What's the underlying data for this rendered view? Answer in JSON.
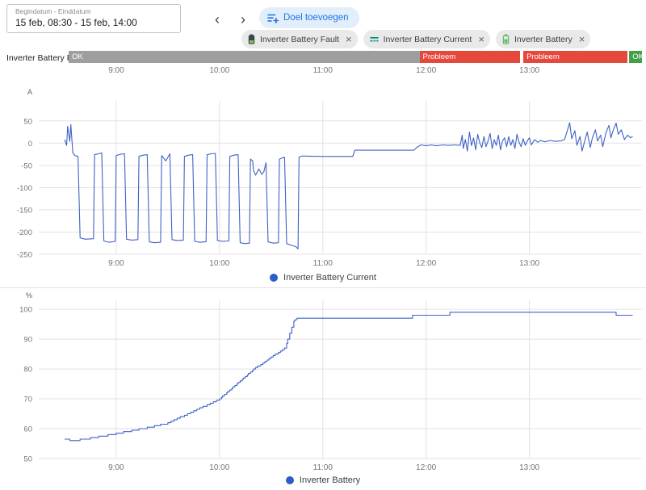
{
  "header": {
    "date_range": {
      "label": "Begindatum - Einddatum",
      "value": "15 feb, 08:30 - 15 feb, 14:00"
    },
    "goal_button_label": "Doel toevoegen",
    "prev_glyph": "‹",
    "next_glyph": "›",
    "close_glyph": "×",
    "chips": [
      {
        "label": "Inverter Battery Fault",
        "icon": "battery-fault-icon"
      },
      {
        "label": "Inverter Battery Current",
        "icon": "battery-current-icon"
      },
      {
        "label": "Inverter Battery",
        "icon": "battery-icon"
      }
    ]
  },
  "status_row": {
    "label": "Inverter Battery Fault",
    "axis_min": 8.5,
    "axis_max": 14.0,
    "segments": [
      {
        "label": "OK",
        "start": 8.5,
        "end": 11.866,
        "color": "#9e9e9e"
      },
      {
        "label": "Probleem",
        "start": 11.866,
        "end": 12.829,
        "color": "#e5483c"
      },
      {
        "label": "Probleem",
        "start": 12.862,
        "end": 13.858,
        "color": "#e5483c"
      },
      {
        "label": "OK",
        "start": 13.878,
        "end": 14.0,
        "color": "#43a047"
      }
    ]
  },
  "time_axis": {
    "xmin": 8.25,
    "xmax": 14.09,
    "ticks": [
      9,
      10,
      11,
      12,
      13
    ],
    "labels": [
      "9:00",
      "10:00",
      "11:00",
      "12:00",
      "13:00"
    ]
  },
  "colors": {
    "line": "#3f62c6",
    "legend_dot": "#2d5bc9",
    "grid": "#e2e2e2",
    "tick_text": "#757575",
    "unit_text": "#616161"
  },
  "chart_data": [
    {
      "type": "line",
      "name": "inverter-battery-current",
      "legend": "Inverter Battery Current",
      "unit": "A",
      "ylim": [
        -250,
        95
      ],
      "yticks": [
        50,
        0,
        -50,
        -100,
        -150,
        -200,
        -250
      ],
      "interpolation": "linear",
      "x_unit": "hour_of_day",
      "points": [
        [
          8.5,
          8
        ],
        [
          8.52,
          -5
        ],
        [
          8.53,
          38
        ],
        [
          8.55,
          4
        ],
        [
          8.56,
          42
        ],
        [
          8.58,
          -22
        ],
        [
          8.6,
          -28
        ],
        [
          8.63,
          -30
        ],
        [
          8.65,
          -213
        ],
        [
          8.7,
          -216
        ],
        [
          8.78,
          -215
        ],
        [
          8.79,
          -26
        ],
        [
          8.83,
          -24
        ],
        [
          8.86,
          -22
        ],
        [
          8.88,
          -220
        ],
        [
          8.93,
          -223
        ],
        [
          8.99,
          -221
        ],
        [
          9.0,
          -28
        ],
        [
          9.04,
          -25
        ],
        [
          9.08,
          -24
        ],
        [
          9.1,
          -216
        ],
        [
          9.15,
          -218
        ],
        [
          9.21,
          -217
        ],
        [
          9.22,
          -30
        ],
        [
          9.26,
          -27
        ],
        [
          9.3,
          -26
        ],
        [
          9.32,
          -222
        ],
        [
          9.37,
          -224
        ],
        [
          9.43,
          -223
        ],
        [
          9.44,
          -28
        ],
        [
          9.48,
          -40
        ],
        [
          9.52,
          -24
        ],
        [
          9.54,
          -217
        ],
        [
          9.59,
          -219
        ],
        [
          9.65,
          -218
        ],
        [
          9.66,
          -30
        ],
        [
          9.7,
          -27
        ],
        [
          9.74,
          -26
        ],
        [
          9.76,
          -221
        ],
        [
          9.81,
          -223
        ],
        [
          9.87,
          -222
        ],
        [
          9.88,
          -26
        ],
        [
          9.92,
          -24
        ],
        [
          9.96,
          -23
        ],
        [
          9.98,
          -219
        ],
        [
          10.03,
          -221
        ],
        [
          10.09,
          -220
        ],
        [
          10.1,
          -30
        ],
        [
          10.14,
          -27
        ],
        [
          10.18,
          -26
        ],
        [
          10.2,
          -224
        ],
        [
          10.25,
          -226
        ],
        [
          10.29,
          -225
        ],
        [
          10.3,
          -36
        ],
        [
          10.32,
          -40
        ],
        [
          10.33,
          -62
        ],
        [
          10.35,
          -72
        ],
        [
          10.38,
          -58
        ],
        [
          10.41,
          -70
        ],
        [
          10.43,
          -64
        ],
        [
          10.45,
          -44
        ],
        [
          10.47,
          -222
        ],
        [
          10.52,
          -225
        ],
        [
          10.57,
          -224
        ],
        [
          10.58,
          -36
        ],
        [
          10.61,
          -33
        ],
        [
          10.63,
          -32
        ],
        [
          10.65,
          -226
        ],
        [
          10.7,
          -230
        ],
        [
          10.74,
          -233
        ],
        [
          10.76,
          -238
        ],
        [
          10.77,
          -32
        ],
        [
          10.8,
          -29
        ],
        [
          11.0,
          -30
        ],
        [
          11.29,
          -30
        ],
        [
          11.31,
          -16
        ],
        [
          11.6,
          -16
        ],
        [
          11.88,
          -16
        ],
        [
          11.92,
          -8
        ],
        [
          11.95,
          -4
        ],
        [
          12.0,
          -6
        ],
        [
          12.05,
          -4
        ],
        [
          12.1,
          -6
        ],
        [
          12.16,
          -4
        ],
        [
          12.22,
          -5
        ],
        [
          12.28,
          -4
        ],
        [
          12.33,
          -5
        ],
        [
          12.35,
          18
        ],
        [
          12.36,
          -12
        ],
        [
          12.38,
          8
        ],
        [
          12.4,
          -18
        ],
        [
          12.42,
          25
        ],
        [
          12.44,
          -6
        ],
        [
          12.46,
          12
        ],
        [
          12.48,
          -15
        ],
        [
          12.5,
          20
        ],
        [
          12.52,
          0
        ],
        [
          12.54,
          -10
        ],
        [
          12.56,
          15
        ],
        [
          12.58,
          -8
        ],
        [
          12.6,
          5
        ],
        [
          12.62,
          22
        ],
        [
          12.64,
          -12
        ],
        [
          12.66,
          8
        ],
        [
          12.68,
          -5
        ],
        [
          12.7,
          18
        ],
        [
          12.72,
          -15
        ],
        [
          12.74,
          5
        ],
        [
          12.76,
          12
        ],
        [
          12.78,
          -8
        ],
        [
          12.8,
          15
        ],
        [
          12.82,
          -5
        ],
        [
          12.84,
          8
        ],
        [
          12.86,
          -12
        ],
        [
          12.88,
          20
        ],
        [
          12.9,
          2
        ],
        [
          12.92,
          -8
        ],
        [
          12.94,
          10
        ],
        [
          12.96,
          -5
        ],
        [
          12.98,
          5
        ],
        [
          13.0,
          12
        ],
        [
          13.02,
          -4
        ],
        [
          13.05,
          8
        ],
        [
          13.08,
          2
        ],
        [
          13.11,
          6
        ],
        [
          13.15,
          3
        ],
        [
          13.2,
          6
        ],
        [
          13.25,
          4
        ],
        [
          13.3,
          5
        ],
        [
          13.34,
          8
        ],
        [
          13.37,
          30
        ],
        [
          13.39,
          46
        ],
        [
          13.41,
          10
        ],
        [
          13.44,
          28
        ],
        [
          13.46,
          -5
        ],
        [
          13.49,
          15
        ],
        [
          13.51,
          -18
        ],
        [
          13.54,
          8
        ],
        [
          13.56,
          25
        ],
        [
          13.59,
          -10
        ],
        [
          13.61,
          12
        ],
        [
          13.64,
          30
        ],
        [
          13.66,
          5
        ],
        [
          13.69,
          18
        ],
        [
          13.71,
          -8
        ],
        [
          13.74,
          22
        ],
        [
          13.77,
          40
        ],
        [
          13.79,
          12
        ],
        [
          13.81,
          28
        ],
        [
          13.84,
          45
        ],
        [
          13.86,
          20
        ],
        [
          13.89,
          30
        ],
        [
          13.92,
          8
        ],
        [
          13.95,
          18
        ],
        [
          13.98,
          12
        ],
        [
          14.0,
          15
        ]
      ]
    },
    {
      "type": "line",
      "name": "inverter-battery",
      "legend": "Inverter Battery",
      "unit": "%",
      "ylim": [
        50,
        103
      ],
      "yticks": [
        100,
        90,
        80,
        70,
        60,
        50
      ],
      "interpolation": "step-after",
      "x_unit": "hour_of_day",
      "points": [
        [
          8.5,
          56.5
        ],
        [
          8.55,
          56
        ],
        [
          8.65,
          56.5
        ],
        [
          8.75,
          57
        ],
        [
          8.83,
          57.5
        ],
        [
          8.92,
          58
        ],
        [
          9.0,
          58.5
        ],
        [
          9.07,
          59
        ],
        [
          9.15,
          59.5
        ],
        [
          9.22,
          60
        ],
        [
          9.3,
          60.5
        ],
        [
          9.37,
          61
        ],
        [
          9.43,
          61.5
        ],
        [
          9.5,
          62
        ],
        [
          9.53,
          62.5
        ],
        [
          9.56,
          63
        ],
        [
          9.59,
          63.5
        ],
        [
          9.62,
          64
        ],
        [
          9.66,
          64.5
        ],
        [
          9.69,
          65
        ],
        [
          9.72,
          65.5
        ],
        [
          9.75,
          66
        ],
        [
          9.78,
          66.5
        ],
        [
          9.81,
          67
        ],
        [
          9.84,
          67.5
        ],
        [
          9.88,
          68
        ],
        [
          9.91,
          68.5
        ],
        [
          9.94,
          69
        ],
        [
          9.97,
          69.5
        ],
        [
          10.0,
          70
        ],
        [
          10.02,
          70.5
        ],
        [
          10.03,
          71
        ],
        [
          10.05,
          71.5
        ],
        [
          10.07,
          72
        ],
        [
          10.08,
          72.5
        ],
        [
          10.1,
          73
        ],
        [
          10.12,
          73.5
        ],
        [
          10.13,
          74
        ],
        [
          10.15,
          74.5
        ],
        [
          10.17,
          75
        ],
        [
          10.18,
          75.5
        ],
        [
          10.2,
          76
        ],
        [
          10.22,
          76.5
        ],
        [
          10.23,
          77
        ],
        [
          10.25,
          77.5
        ],
        [
          10.27,
          78
        ],
        [
          10.28,
          78.5
        ],
        [
          10.3,
          79
        ],
        [
          10.32,
          79.5
        ],
        [
          10.33,
          80
        ],
        [
          10.35,
          80.5
        ],
        [
          10.37,
          81
        ],
        [
          10.4,
          81.5
        ],
        [
          10.42,
          82
        ],
        [
          10.44,
          82.5
        ],
        [
          10.46,
          83
        ],
        [
          10.48,
          83.5
        ],
        [
          10.5,
          84
        ],
        [
          10.52,
          84.5
        ],
        [
          10.54,
          85
        ],
        [
          10.57,
          85.5
        ],
        [
          10.59,
          86
        ],
        [
          10.61,
          86.5
        ],
        [
          10.63,
          87
        ],
        [
          10.65,
          88.5
        ],
        [
          10.66,
          90
        ],
        [
          10.68,
          92
        ],
        [
          10.7,
          94
        ],
        [
          10.72,
          96
        ],
        [
          10.73,
          96.5
        ],
        [
          10.75,
          97
        ],
        [
          11.85,
          97
        ],
        [
          11.87,
          98
        ],
        [
          12.2,
          98
        ],
        [
          12.23,
          99
        ],
        [
          13.8,
          99
        ],
        [
          13.84,
          98
        ],
        [
          14.0,
          98
        ]
      ]
    }
  ]
}
